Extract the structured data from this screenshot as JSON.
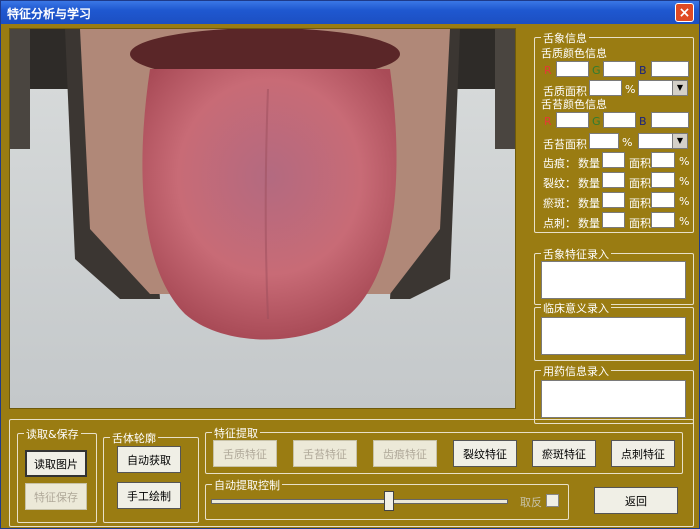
{
  "window": {
    "title": "特征分析与学习",
    "close": "×"
  },
  "tongue_info": {
    "title": "舌象信息",
    "body_color": {
      "label": "舌质颜色信息",
      "r": "R",
      "g": "G",
      "b": "B",
      "area_label": "舌质面积",
      "pct": "%"
    },
    "coat_color": {
      "label": "舌苔颜色信息",
      "r": "R",
      "g": "G",
      "b": "B",
      "area_label": "舌苔面积",
      "pct": "%"
    },
    "rows": [
      {
        "name": "齿痕：",
        "count": "数量",
        "area": "面积",
        "pct": "%"
      },
      {
        "name": "裂纹：",
        "count": "数量",
        "area": "面积",
        "pct": "%"
      },
      {
        "name": "瘀斑：",
        "count": "数量",
        "area": "面积",
        "pct": "%"
      },
      {
        "name": "点刺：",
        "count": "数量",
        "area": "面积",
        "pct": "%"
      }
    ]
  },
  "feature_entry": {
    "title": "舌象特征录入"
  },
  "clinical_entry": {
    "title": "临床意义录入"
  },
  "medication_entry": {
    "title": "用药信息录入"
  },
  "read_save": {
    "title": "读取&保存",
    "read": "读取图片",
    "save": "特征保存"
  },
  "contour": {
    "title": "舌体轮廓",
    "auto": "自动获取",
    "manual": "手工绘制"
  },
  "extract": {
    "title": "特征提取",
    "buttons": [
      "舌质特征",
      "舌苔特征",
      "齿痕特征",
      "裂纹特征",
      "瘀斑特征",
      "点刺特征"
    ]
  },
  "auto_control": {
    "title": "自动提取控制",
    "invert": "取反",
    "slider_value": 0.6
  },
  "back": "返回",
  "colors": {
    "title_bg": "#1f58d0",
    "panel": "#9a7c12",
    "tongue": "#c96a74"
  }
}
